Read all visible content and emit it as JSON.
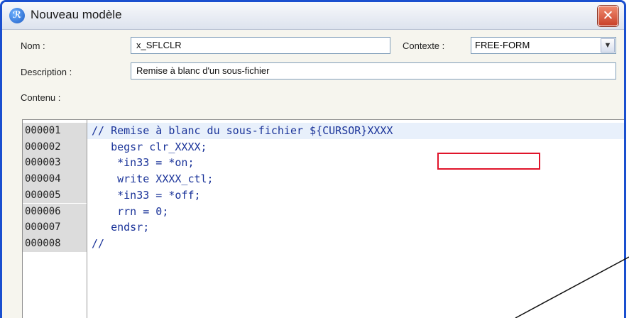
{
  "window": {
    "title": "Nouveau modèle",
    "close_symbol": "✕",
    "app_icon": "rdi-app-icon"
  },
  "form": {
    "name_label": "Nom :",
    "name_value": "x_SFLCLR",
    "context_label": "Contexte :",
    "context_value": "FREE-FORM",
    "description_label": "Description :",
    "description_value": "Remise à blanc d'un sous-fichier",
    "content_label": "Contenu :"
  },
  "editor": {
    "lines": [
      {
        "number": "000001",
        "code": "// Remise à blanc du sous-fichier ${CURSOR}XXXX"
      },
      {
        "number": "000002",
        "code": "   begsr clr_XXXX;"
      },
      {
        "number": "000003",
        "code": "    *in33 = *on;"
      },
      {
        "number": "000004",
        "code": "    write XXXX_ctl;"
      },
      {
        "number": "000005",
        "code": "    *in33 = *off;"
      },
      {
        "number": "000006",
        "code": "    rrn = 0;"
      },
      {
        "number": "000007",
        "code": "   endsr;"
      },
      {
        "number": "000008",
        "code": "//"
      }
    ]
  },
  "colors": {
    "highlight": "#e0142a",
    "code_text": "#1a3399",
    "title_frame": "#1a4fcf"
  }
}
